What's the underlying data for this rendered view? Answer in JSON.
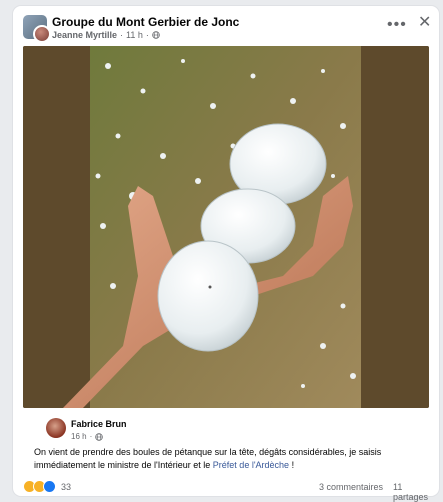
{
  "post": {
    "group_name": "Groupe du Mont Gerbier de Jonc",
    "poster_name": "Jeanne Myrtille",
    "time": "11 h",
    "separator": "·"
  },
  "actions": {
    "more_label": "•••",
    "close_label": "✕"
  },
  "comment": {
    "author": "Fabrice Brun",
    "time": "16 h",
    "separator": "·",
    "text_before": "On vient de prendre des boules de pétanque sur la tête, dégâts considérables, je saisis immédiatement le ministre de l'Intérieur et le ",
    "link_text": "Préfet de l'Ardèche",
    "text_after": " !"
  },
  "footer": {
    "reaction_count": "33",
    "comments": "3 commentaires",
    "shares": "11 partages"
  },
  "icons": [
    "globe-icon",
    "wow-icon",
    "sad-icon",
    "like-icon"
  ],
  "colors": {
    "link": "#385898",
    "meta": "#65676b",
    "like": "#1877f2"
  }
}
